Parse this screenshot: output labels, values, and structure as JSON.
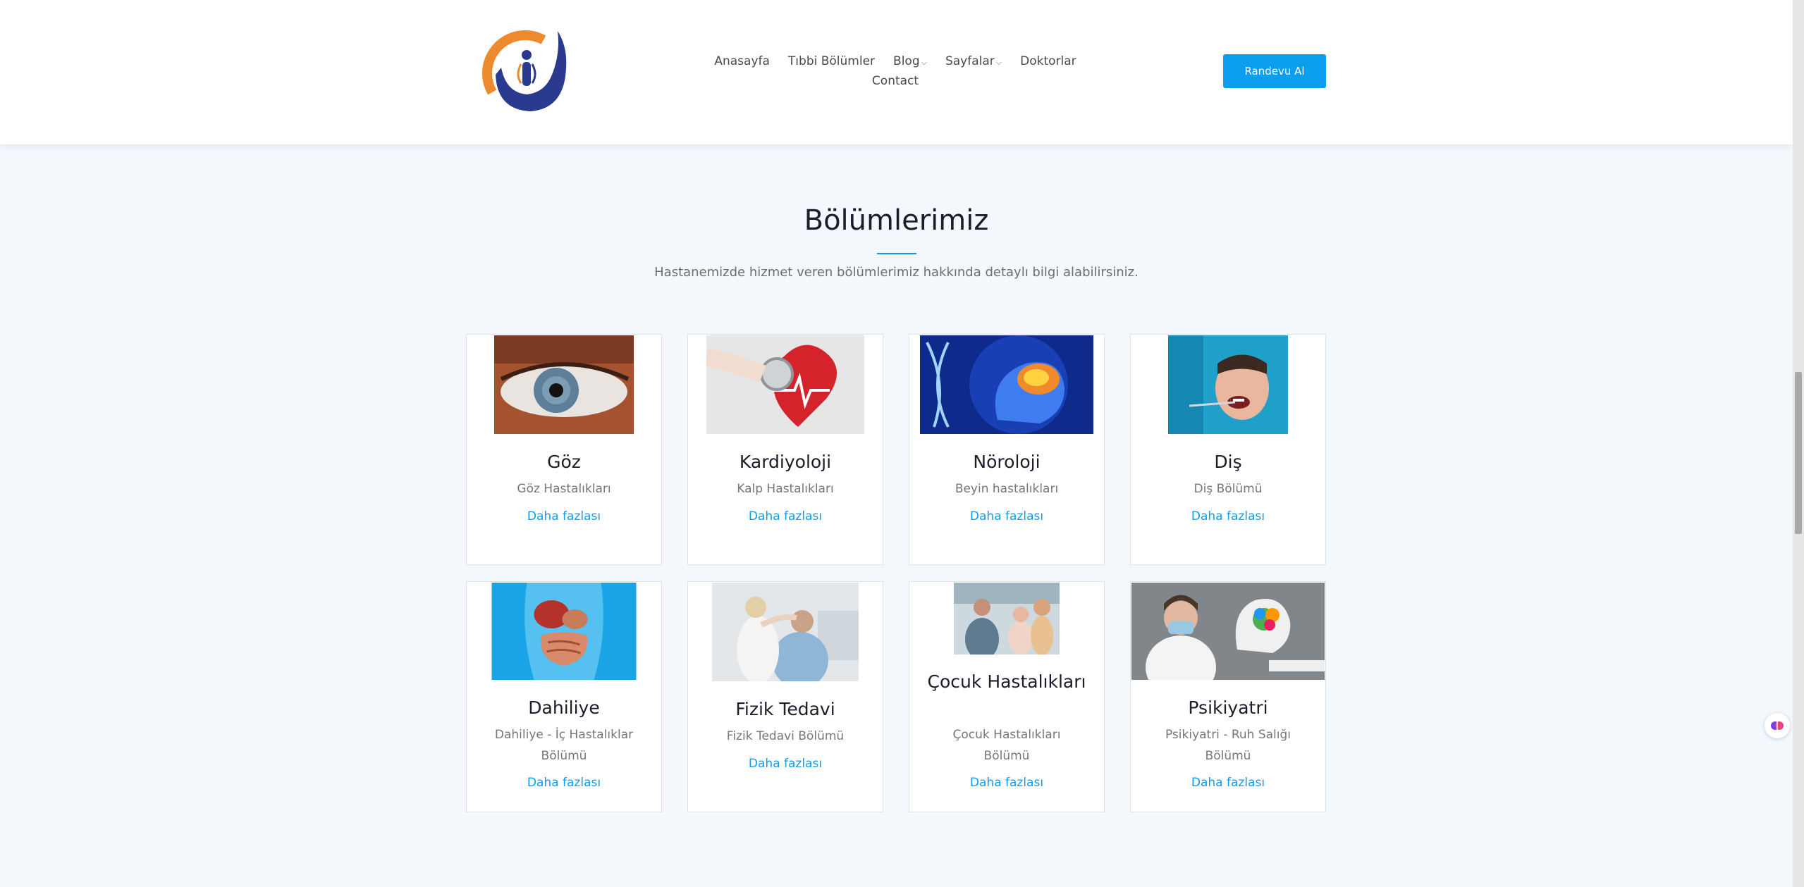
{
  "header": {
    "nav": [
      {
        "label": "Anasayfa"
      },
      {
        "label": "Tıbbi Bölümler"
      },
      {
        "label": "Blog",
        "dropdown": true
      },
      {
        "label": "Sayfalar",
        "dropdown": true
      },
      {
        "label": "Doktorlar"
      }
    ],
    "nav_row2": "Contact",
    "cta_label": "Randevu Al"
  },
  "section": {
    "title": "Bölümlerimiz",
    "subtitle": "Hastanemizde hizmet veren bölümlerimiz hakkında detaylı bilgi alabilirsiniz."
  },
  "cards": [
    {
      "title": "Göz",
      "desc": "Göz Hastalıkları",
      "link": "Daha fazlası",
      "image": "eye-photo"
    },
    {
      "title": "Kardiyoloji",
      "desc": "Kalp Hastalıkları",
      "link": "Daha fazlası",
      "image": "stethoscope-heart-photo"
    },
    {
      "title": "Nöroloji",
      "desc": "Beyin hastalıkları",
      "link": "Daha fazlası",
      "image": "brain-dna-photo"
    },
    {
      "title": "Diş",
      "desc": "Diş Bölümü",
      "link": "Daha fazlası",
      "image": "dentist-photo"
    },
    {
      "title": "Dahiliye",
      "desc": "Dahiliye - İç Hastalıklar Bölümü",
      "link": "Daha fazlası",
      "image": "internal-organs-photo"
    },
    {
      "title": "Fizik Tedavi",
      "desc": "Fizik Tedavi Bölümü",
      "link": "Daha fazlası",
      "image": "physiotherapy-photo"
    },
    {
      "title": "Çocuk Hastalıkları",
      "desc": "Çocuk Hastalıkları Bölümü",
      "link": "Daha fazlası",
      "image": "pediatrics-photo"
    },
    {
      "title": "Psikiyatri",
      "desc": "Psikiyatri - Ruh Salığı Bölümü",
      "link": "Daha fazlası",
      "image": "psychiatry-photo"
    }
  ],
  "colors": {
    "accent": "#0b9dee",
    "background": "#f3f8fd",
    "logo_orange": "#ee8a2e",
    "logo_navy": "#2a3a8e"
  }
}
